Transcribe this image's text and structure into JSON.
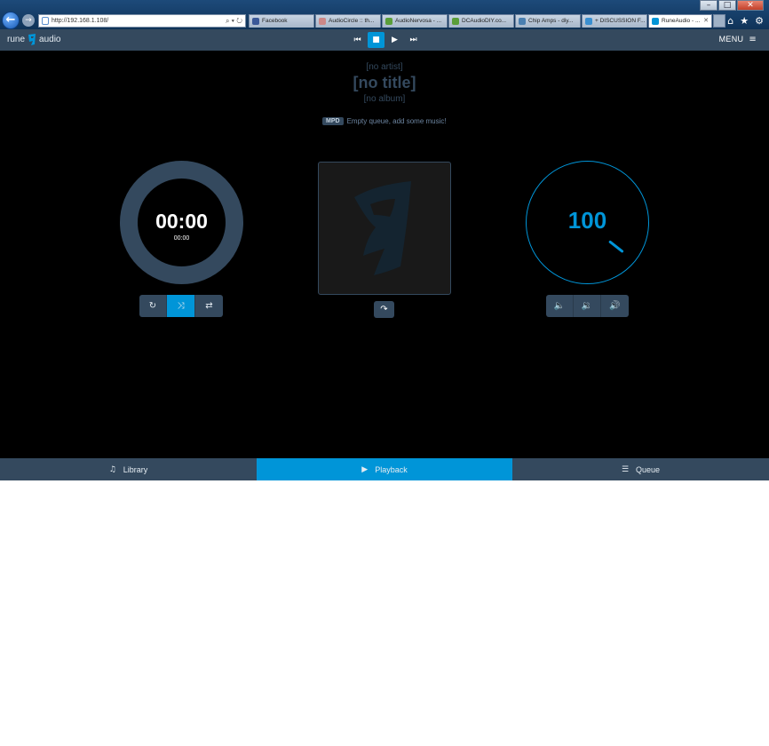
{
  "browser": {
    "url": "http://192.168.1.108/",
    "url_tools": "⌕ ▾ ↻",
    "back_glyph": "←",
    "forward_glyph": "→",
    "window_buttons": [
      "–",
      "□",
      "✕"
    ],
    "tabs": [
      {
        "label": "Facebook",
        "favicon_color": "#3b5998"
      },
      {
        "label": "AudioCircle :: th...",
        "favicon_color": "#c88"
      },
      {
        "label": "AudioNervosa - ...",
        "favicon_color": "#5a9e3a"
      },
      {
        "label": "DCAudioDIY.co...",
        "favicon_color": "#5a9e3a"
      },
      {
        "label": "Chip Amps - diy...",
        "favicon_color": "#4a7fb0"
      },
      {
        "label": "+ DISCUSSION F...",
        "favicon_color": "#3a8fd0"
      },
      {
        "label": "RuneAudio - ...",
        "favicon_color": "#0095d8",
        "close": "✕"
      }
    ],
    "toolbar_icons": [
      "⌂",
      "★",
      "⚙"
    ]
  },
  "app": {
    "logo_left": "rune",
    "logo_right": "audio",
    "transport": [
      {
        "name": "previous",
        "glyph": "⏮"
      },
      {
        "name": "stop",
        "glyph": "■"
      },
      {
        "name": "play",
        "glyph": "▶"
      },
      {
        "name": "next",
        "glyph": "⏭"
      }
    ],
    "menu_label": "MENU",
    "menu_glyph": "≡",
    "now_playing": {
      "artist": "[no artist]",
      "title": "[no title]",
      "album": "[no album]"
    },
    "status": {
      "badge": "MPD",
      "text": "Empty queue, add some music!"
    },
    "time": {
      "elapsed": "00:00",
      "total": "00:00"
    },
    "playback_controls": [
      {
        "name": "repeat",
        "glyph": "↻",
        "active": false
      },
      {
        "name": "random",
        "glyph": "⤨",
        "active": true
      },
      {
        "name": "consume",
        "glyph": "⇄",
        "active": false
      }
    ],
    "share_glyph": "↷",
    "volume": {
      "value": "100",
      "controls": [
        {
          "name": "volume-down",
          "glyph": "🔈"
        },
        {
          "name": "volume-mute",
          "glyph": "🔉"
        },
        {
          "name": "volume-up",
          "glyph": "🔊"
        }
      ]
    },
    "bottom_nav": [
      {
        "label": "Library",
        "glyph": "♫",
        "active": false
      },
      {
        "label": "Playback",
        "glyph": "▶",
        "active": true
      },
      {
        "label": "Queue",
        "glyph": "☰",
        "active": false
      }
    ],
    "colors": {
      "accent": "#0095d8",
      "panel": "#34495e",
      "background": "#000000"
    }
  }
}
